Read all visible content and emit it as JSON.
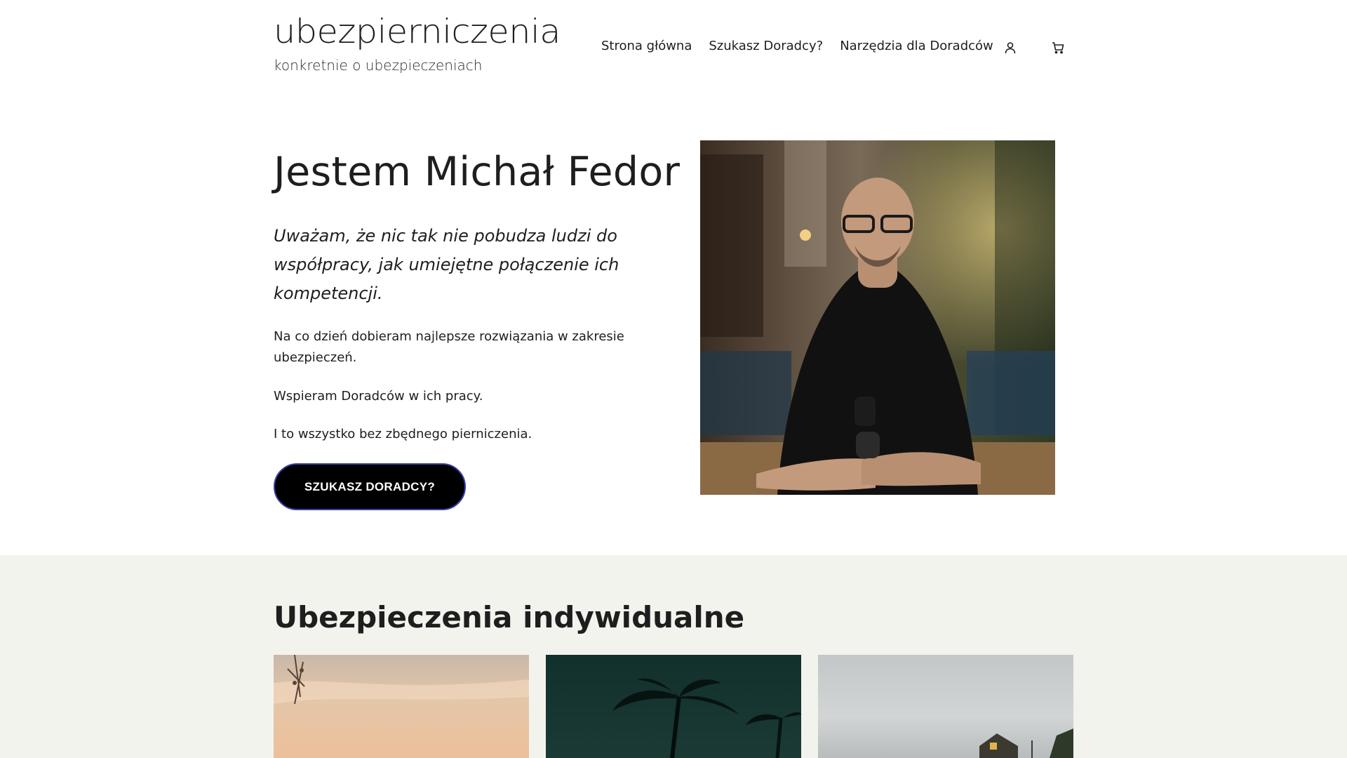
{
  "header": {
    "brand_name": "ubezpierniczenia",
    "brand_tagline": "konkretnie o ubezpieczeniach",
    "nav": [
      {
        "label": "Strona główna"
      },
      {
        "label": "Szukasz Doradcy?"
      },
      {
        "label": "Narzędzia dla Doradców"
      }
    ],
    "account_icon": "user-icon",
    "cart_icon": "cart-icon"
  },
  "hero": {
    "title": "Jestem Michał Fedor",
    "quote": "Uważam, że nic tak nie pobudza ludzi do współpracy, jak umiejętne połączenie ich kompetencji.",
    "paragraphs": [
      "Na co dzień dobieram najlepsze rozwiązania w zakresie ubezpieczeń.",
      "Wspieram Doradców w ich pracy.",
      "I to wszystko bez zbędnego pierniczenia."
    ],
    "cta_label": "SZUKASZ DORADCY?"
  },
  "section": {
    "title": "Ubezpieczenia indywidualne"
  },
  "colors": {
    "text": "#1e1e1e",
    "cta_bg": "#000000",
    "cta_border": "#3b3fa8",
    "section_bg": "#f3f3ee"
  }
}
